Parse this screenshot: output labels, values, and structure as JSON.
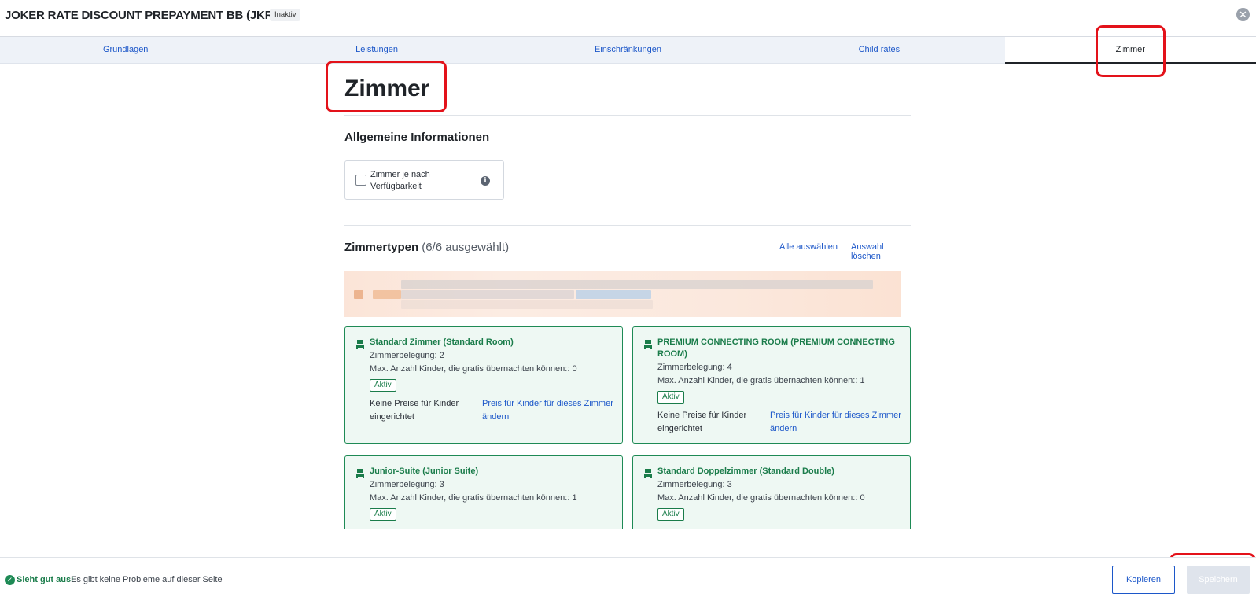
{
  "header": {
    "title": "JOKER RATE DISCOUNT PREPAYMENT BB (JKR)",
    "status_badge": "Inaktiv",
    "close_icon": "close-icon"
  },
  "tabs": [
    {
      "label": "Grundlagen",
      "active": false
    },
    {
      "label": "Leistungen",
      "active": false
    },
    {
      "label": "Einschränkungen",
      "active": false
    },
    {
      "label": "Child rates",
      "active": false
    },
    {
      "label": "Zimmer",
      "active": true
    }
  ],
  "main": {
    "page_title": "Zimmer",
    "general": {
      "heading": "Allgemeine Informationen",
      "checkbox_label": "Zimmer je nach Verfügbarkeit",
      "checkbox_checked": false
    },
    "roomtypes": {
      "heading": "Zimmertypen",
      "count": "(6/6 ausgewählt)",
      "select_all": "Alle auswählen",
      "clear_selection": "Auswahl löschen"
    },
    "rooms": [
      {
        "name": "Standard Zimmer (Standard Room)",
        "occupancy": "Zimmerbelegung: 2",
        "max_children": "Max. Anzahl Kinder, die gratis übernachten können:: 0",
        "status": "Aktiv",
        "kids_text": "Keine Preise für Kinder eingerichtet",
        "kids_link": "Preis für Kinder für dieses Zimmer ändern"
      },
      {
        "name": "PREMIUM CONNECTING ROOM (PREMIUM CONNECTING ROOM)",
        "occupancy": "Zimmerbelegung: 4",
        "max_children": "Max. Anzahl Kinder, die gratis übernachten können:: 1",
        "status": "Aktiv",
        "kids_text": "Keine Preise für Kinder eingerichtet",
        "kids_link": "Preis für Kinder für dieses Zimmer ändern"
      },
      {
        "name": "Junior-Suite (Junior Suite)",
        "occupancy": "Zimmerbelegung: 3",
        "max_children": "Max. Anzahl Kinder, die gratis übernachten können:: 1",
        "status": "Aktiv"
      },
      {
        "name": "Standard Doppelzimmer (Standard Double)",
        "occupancy": "Zimmerbelegung: 3",
        "max_children": "Max. Anzahl Kinder, die gratis übernachten können:: 0",
        "status": "Aktiv"
      }
    ]
  },
  "footer": {
    "status_strong": "Sieht gut aus!",
    "status_text": "Es gibt keine Probleme auf dieser Seite",
    "copy_label": "Kopieren",
    "save_label": "Speichern"
  },
  "colors": {
    "accent": "#1c57c9",
    "success": "#1a7c4a",
    "room_bg": "#eef8f3",
    "highlight": "#e3121a"
  }
}
